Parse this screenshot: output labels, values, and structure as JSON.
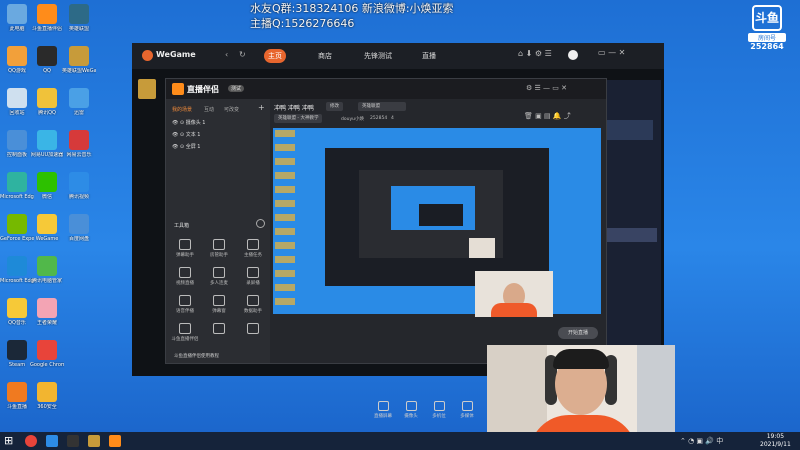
{
  "overlay": {
    "line1": "水友Q群:318324106 新浪微博:小焕亚索",
    "line2": "主播Q:1526276646"
  },
  "douyu": {
    "logo": "斗鱼",
    "sublabel": "房间号",
    "room": "252864"
  },
  "desktop_icons": [
    {
      "label": "此电脑",
      "color": "#6aa9e0"
    },
    {
      "label": "QQ游戏",
      "color": "#f2a03a"
    },
    {
      "label": "回收站",
      "color": "#cfe0ef"
    },
    {
      "label": "控制面板",
      "color": "#4a8fd8"
    },
    {
      "label": "Microsoft Edge",
      "color": "#2fb3a0"
    },
    {
      "label": "GeForce Experience",
      "color": "#76b900"
    },
    {
      "label": "Microsoft Edge",
      "color": "#1e8ad8"
    },
    {
      "label": "QQ音乐",
      "color": "#f6c938"
    },
    {
      "label": "Steam",
      "color": "#1b2838"
    },
    {
      "label": "斗鱼直播",
      "color": "#f07a20"
    }
  ],
  "desktop_icons_col2": [
    {
      "label": "斗鱼直播伴侣",
      "color": "#ff8c1a"
    },
    {
      "label": "QQ",
      "color": "#2a2a2a"
    },
    {
      "label": "腾讯QQ",
      "color": "#f0c23a"
    },
    {
      "label": "网易UU加速器",
      "color": "#3ab5e6"
    },
    {
      "label": "微信",
      "color": "#2dc100"
    },
    {
      "label": "WeGame",
      "color": "#f6c938"
    },
    {
      "label": "腾讯电脑管家",
      "color": "#51b84a"
    },
    {
      "label": "王者荣耀",
      "color": "#f3a4b4"
    },
    {
      "label": "Google Chrome",
      "color": "#e8443a"
    },
    {
      "label": "360安全",
      "color": "#f2b530"
    }
  ],
  "desktop_icons_col3": [
    {
      "label": "英雄联盟",
      "color": "#2d6a87"
    },
    {
      "label": "英雄联盟WeGame版",
      "color": "#c79b3a"
    },
    {
      "label": "迅雷",
      "color": "#4aa0e6"
    },
    {
      "label": "网易云音乐",
      "color": "#d63a3a"
    },
    {
      "label": "腾讯视频",
      "color": "#2d8ce6"
    },
    {
      "label": "百度网盘",
      "color": "#4a8fd8"
    }
  ],
  "wegame": {
    "logo": "WeGame",
    "tabs": [
      "主页",
      "商店",
      "先锋测试",
      "直播"
    ]
  },
  "zhibo": {
    "title": "直播伴侣",
    "badge": "测试",
    "tabs": [
      "我的场景",
      "互动",
      "可改变"
    ],
    "scenes": [
      "摄像头 1",
      "文本 1",
      "全屏 1"
    ],
    "stream_title": "冲鸭 冲鸭 冲鸭",
    "btn_modify": "修改",
    "category": "英雄联盟",
    "category2": "英雄联盟 - 大神教学",
    "room_label": "douyu小焕",
    "room_id": "252854",
    "viewers": "4",
    "tools_header": "工具箱",
    "tools": [
      "弹幕助手",
      "房管助手",
      "主播任务",
      "视频直播",
      "多人连麦",
      "录屏播",
      "语音伴播",
      "弹幕窗",
      "数据助手",
      "斗鱼直播伴侣",
      "",
      ""
    ],
    "bottom_buttons": [
      "直播屏幕",
      "摄像头",
      "多机位",
      "多媒体",
      "麦克风",
      "扬声器"
    ],
    "start_button": "开始直播",
    "status": "斗鱼直播伴侣使用教程"
  },
  "clock": {
    "time": "19:05",
    "date": "2021/9/11"
  },
  "accent": "#e8662e"
}
